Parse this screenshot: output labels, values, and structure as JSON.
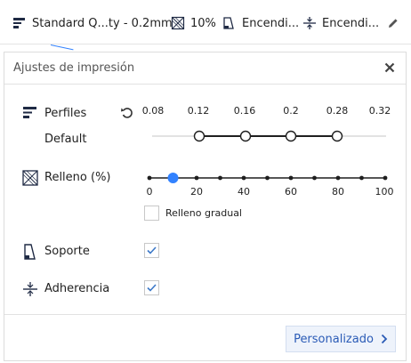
{
  "topbar": {
    "profile_label": "Standard Q...ty - 0.2mm",
    "infill_label": "10%",
    "support_label": "Encendi...",
    "adhesion_label": "Encendi..."
  },
  "panel": {
    "title": "Ajustes de impresión",
    "profiles": {
      "label": "Perfiles",
      "sublabel": "Default",
      "ticks": [
        "0.08",
        "0.12",
        "0.16",
        "0.2",
        "0.28",
        "0.32"
      ]
    },
    "infill": {
      "label": "Relleno (%)",
      "ticks": [
        "0",
        "20",
        "40",
        "60",
        "80",
        "100"
      ],
      "value_percent": 10,
      "gradual_label": "Relleno gradual",
      "gradual_checked": false
    },
    "support": {
      "label": "Soporte",
      "checked": true
    },
    "adhesion": {
      "label": "Adherencia",
      "checked": true
    },
    "custom_button": "Personalizado"
  },
  "colors": {
    "accent": "#3282ff",
    "button_text": "#2a5bb6",
    "check": "#3c78c8"
  }
}
